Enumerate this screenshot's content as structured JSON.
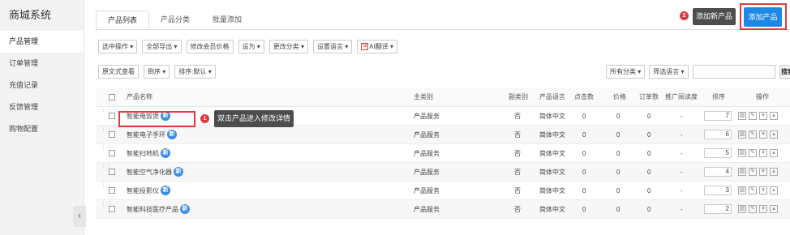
{
  "sidebar": {
    "title": "商城系统",
    "items": [
      {
        "label": "产品管理",
        "active": true
      },
      {
        "label": "订单管理",
        "active": false
      },
      {
        "label": "充值记录",
        "active": false
      },
      {
        "label": "反馈管理",
        "active": false
      },
      {
        "label": "购物配置",
        "active": false
      }
    ],
    "collapse_glyph": "‹"
  },
  "tabs": [
    "产品列表",
    "产品分类",
    "批量添加"
  ],
  "add_button": {
    "label": "添加产品",
    "badge": "2",
    "tooltip": "添加新产品"
  },
  "toolbar": {
    "buttons": [
      "选中操作 ▾",
      "全部导出 ▾",
      "修改会员价格",
      "设为 ▾",
      "更改分类 ▾",
      "设置语言 ▾",
      "AI翻译 ▾"
    ],
    "ai_icon": "译"
  },
  "toolbar2": {
    "buttons": [
      "原文式查看",
      "倒序 ▾",
      "排序:默认 ▾"
    ],
    "right_buttons": [
      "所有分类 ▾",
      "筛选语言 ▾"
    ],
    "search_label": "搜索",
    "search_placeholder": ""
  },
  "table": {
    "columns": [
      "产品名称",
      "主类别",
      "副类别",
      "产品语言",
      "点击数",
      "价格",
      "订单数",
      "推广阅读度",
      "排序",
      "操作"
    ],
    "new_badge": "新",
    "rows": [
      {
        "name": "智能电饭煲",
        "main": "产品服务",
        "sub": "否",
        "lang": "简体中文",
        "clicks": "0",
        "price": "0",
        "orders": "0",
        "promo": "-",
        "sort": "7"
      },
      {
        "name": "智能电子手环",
        "main": "产品服务",
        "sub": "否",
        "lang": "简体中文",
        "clicks": "0",
        "price": "0",
        "orders": "0",
        "promo": "-",
        "sort": "6"
      },
      {
        "name": "智能扫地机",
        "main": "产品服务",
        "sub": "否",
        "lang": "简体中文",
        "clicks": "0",
        "price": "0",
        "orders": "0",
        "promo": "-",
        "sort": "5"
      },
      {
        "name": "智能空气净化器",
        "main": "产品服务",
        "sub": "否",
        "lang": "简体中文",
        "clicks": "0",
        "price": "0",
        "orders": "0",
        "promo": "-",
        "sort": "4"
      },
      {
        "name": "智能投影仪",
        "main": "产品服务",
        "sub": "否",
        "lang": "简体中文",
        "clicks": "0",
        "price": "0",
        "orders": "0",
        "promo": "-",
        "sort": "3"
      },
      {
        "name": "智能科技医疗产品",
        "main": "产品服务",
        "sub": "否",
        "lang": "简体中文",
        "clicks": "0",
        "price": "0",
        "orders": "0",
        "promo": "-",
        "sort": "2"
      }
    ]
  },
  "annotation_1": {
    "badge": "1",
    "tooltip": "双击产品进入修改详情"
  },
  "colors": {
    "accent": "#1e88e5",
    "highlight": "#e4393c",
    "tooltip_bg": "#4d4d4d"
  }
}
